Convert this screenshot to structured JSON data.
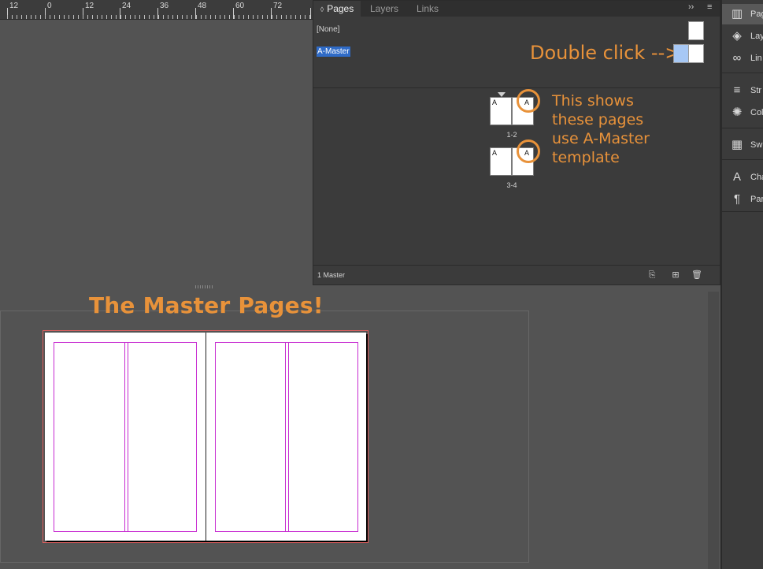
{
  "ruler": {
    "labels": [
      "12",
      "0",
      "12",
      "24",
      "36",
      "48",
      "60",
      "72"
    ]
  },
  "canvas": {
    "headline": "The Master Pages!"
  },
  "pages_panel": {
    "tabs": [
      {
        "label": "Pages",
        "active": true
      },
      {
        "label": "Layers",
        "active": false
      },
      {
        "label": "Links",
        "active": false
      }
    ],
    "menu_glyph": "››",
    "masters": [
      {
        "label": "[None]",
        "selected": false
      },
      {
        "label": "A-Master",
        "selected": true
      }
    ],
    "double_click_note": "Double click -->",
    "spreads": [
      {
        "label": "1-2",
        "left_master": "A",
        "right_master": "A"
      },
      {
        "label": "3-4",
        "left_master": "A",
        "right_master": "A"
      }
    ],
    "note_lines": [
      "This shows",
      "these pages",
      "use A-Master",
      "template"
    ],
    "status": "1 Master",
    "accent_color": "#e8923a"
  },
  "dock": {
    "items": [
      {
        "label": "Pag",
        "icon": "pages-icon",
        "active": true
      },
      {
        "label": "Lay",
        "icon": "layers-icon",
        "active": false
      },
      {
        "label": "Lin",
        "icon": "links-icon",
        "active": false
      },
      {
        "label": "Str",
        "icon": "stroke-icon",
        "active": false
      },
      {
        "label": "Col",
        "icon": "color-icon",
        "active": false
      },
      {
        "label": "Sw",
        "icon": "swatches-icon",
        "active": false
      },
      {
        "label": "Cha",
        "icon": "character-icon",
        "active": false
      },
      {
        "label": "Par",
        "icon": "paragraph-icon",
        "active": false
      }
    ]
  }
}
